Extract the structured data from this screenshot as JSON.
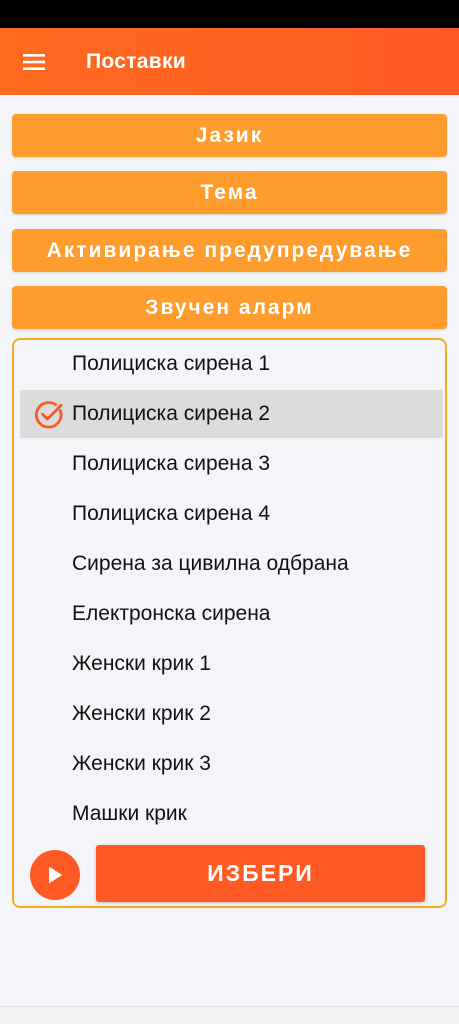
{
  "appbar": {
    "title": "Поставки",
    "menu_icon": "hamburger-icon"
  },
  "sections": [
    {
      "label": "Јазик"
    },
    {
      "label": "Тема"
    },
    {
      "label": "Активирање предупредување"
    },
    {
      "label": "Звучен аларм"
    }
  ],
  "sounds": {
    "items": [
      {
        "label": "Полициска сирена 1"
      },
      {
        "label": "Полициска сирена 2"
      },
      {
        "label": "Полициска сирена 3"
      },
      {
        "label": "Полициска сирена 4"
      },
      {
        "label": "Сирена за цивилна одбрана"
      },
      {
        "label": "Електронска сирена"
      },
      {
        "label": "Женски крик 1"
      },
      {
        "label": "Женски крик 2"
      },
      {
        "label": "Женски крик 3"
      },
      {
        "label": "Машки крик"
      }
    ],
    "selected_index": 1,
    "select_label": "ИЗБЕРИ",
    "play_icon": "play-icon"
  },
  "colors": {
    "accent": "#ff5a24",
    "section_button": "#ff9c2e",
    "panel_border": "#f4ab20",
    "selected_row": "#dcdcdc"
  }
}
